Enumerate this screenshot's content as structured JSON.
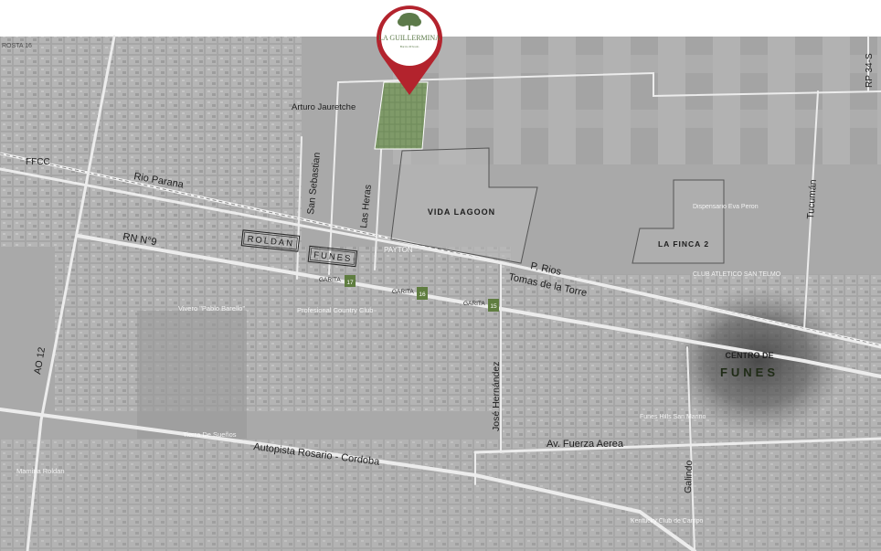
{
  "brand": {
    "name": "LA GUILLERMINA",
    "tagline": "Barrio Privado"
  },
  "colors": {
    "pin": "#b3232d",
    "lot_green": "#6f8b5b",
    "garita_green": "#5f7d40",
    "map_base": "#a9a9a9",
    "road": "#ececec"
  },
  "roads": {
    "rp34s": "RP 34-S",
    "rosta16": "ROSTA 16",
    "arturo_jauretche": "Arturo Jauretche",
    "ffcc": "FFCC",
    "rio_parana": "Rio Parana",
    "san_sebastian": "San Sebastian",
    "las_heras": "Las Heras",
    "rn9": "RN N°9",
    "p_rios": "P. Rios",
    "tomas_de_la_torre": "Tomas de la Torre",
    "tucuman": "Tucumán",
    "ao12": "AO 12",
    "jose_hernandez": "José Hernández",
    "av_fuerza_aerea": "Av. Fuerza Aerea",
    "autopista": "Autopista Rosario - Cordoba",
    "galindo": "Galindo"
  },
  "zones": {
    "vida_lagoon": "VIDA LAGOON",
    "la_finca_2": "LA FINCA 2",
    "roldan": "ROLDAN",
    "funes": "FUNES",
    "centro_line1": "CENTRO DE",
    "centro_line2": "FUNES"
  },
  "garitas": [
    {
      "label": "GARITA",
      "number": "17"
    },
    {
      "label": "GARITA",
      "number": "16"
    },
    {
      "label": "GARITA",
      "number": "15"
    }
  ],
  "pois": {
    "payton": "PAYTON",
    "vivero": "Vivero \"Pablo Barello\"",
    "country_club": "Profesional Country Club",
    "tierra_suenos": "Tierra De Sueños",
    "mamina": "Mamina Roldan",
    "dispensario": "Dispensario Eva Peron",
    "club_atletico": "CLUB ATLETICO SAN TELMO",
    "fuerza_aerea_poi": "Funes Hills San Marino",
    "kentucky": "Kentucky Club de Campo"
  }
}
